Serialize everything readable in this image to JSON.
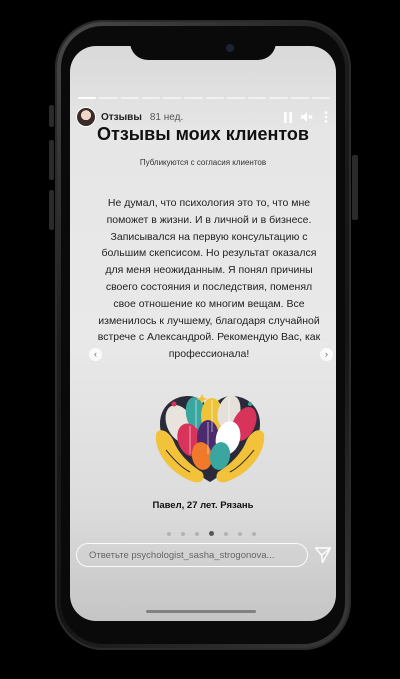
{
  "story": {
    "account_name": "Отзывы",
    "time_ago": "81 нед.",
    "progress": {
      "total": 12,
      "current": 1
    }
  },
  "content": {
    "title": "Отзывы моих клиентов",
    "subtitle": "Публикуются с согласия клиентов",
    "review_text": "Не думал, что психология это то, что мне поможет в жизни. И в личной и в бизнесе. Записывался на первую консультацию с большим скепсисом. Но результат оказался для меня неожиданным. Я понял причины своего состояния и последствия, поменял свое отношение ко многим вещам. Все изменилось к лучшему, благодаря случайной встрече с Александрой. Рекомендую Вас, как профессионала!",
    "author": "Павел, 27 лет. Рязань"
  },
  "carousel": {
    "dots": 7,
    "active_index": 3
  },
  "reply": {
    "placeholder": "Ответьте psychologist_sasha_strogonova..."
  },
  "icons": {
    "pause": "pause-icon",
    "mute": "speaker-muted-icon",
    "more": "more-vertical-icon",
    "send": "paper-plane-icon",
    "prev": "chevron-left-icon",
    "next": "chevron-right-icon"
  }
}
